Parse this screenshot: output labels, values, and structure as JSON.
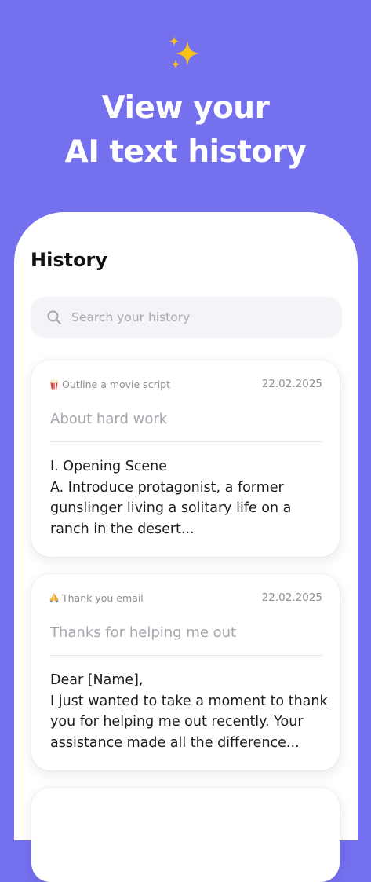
{
  "hero": {
    "title_line1": "View your",
    "title_line2": "AI text history",
    "icon": "sparkles-icon"
  },
  "screen": {
    "title": "History",
    "search": {
      "placeholder": "Search your history",
      "icon": "search-icon"
    }
  },
  "history": [
    {
      "tag_icon": "popcorn-icon",
      "tag": "Outline a movie script",
      "date": "22.02.2025",
      "subject": "About hard work",
      "body_lines": [
        "I. Opening Scene",
        "A. Introduce protagonist, a former",
        "gunslinger living a solitary life on a",
        "ranch in the desert..."
      ]
    },
    {
      "tag_icon": "folded-hands-icon",
      "tag": "Thank you email",
      "date": "22.02.2025",
      "subject": "Thanks for helping me out",
      "body_lines": [
        "Dear [Name],",
        "I just wanted to take a moment to thank",
        "you for helping me out recently. Your",
        "assistance made all the difference..."
      ]
    }
  ],
  "colors": {
    "background": "#7570EE",
    "card": "#FFFFFF",
    "search_bg": "#F3F4F8",
    "muted_text": "#8E8E96"
  }
}
